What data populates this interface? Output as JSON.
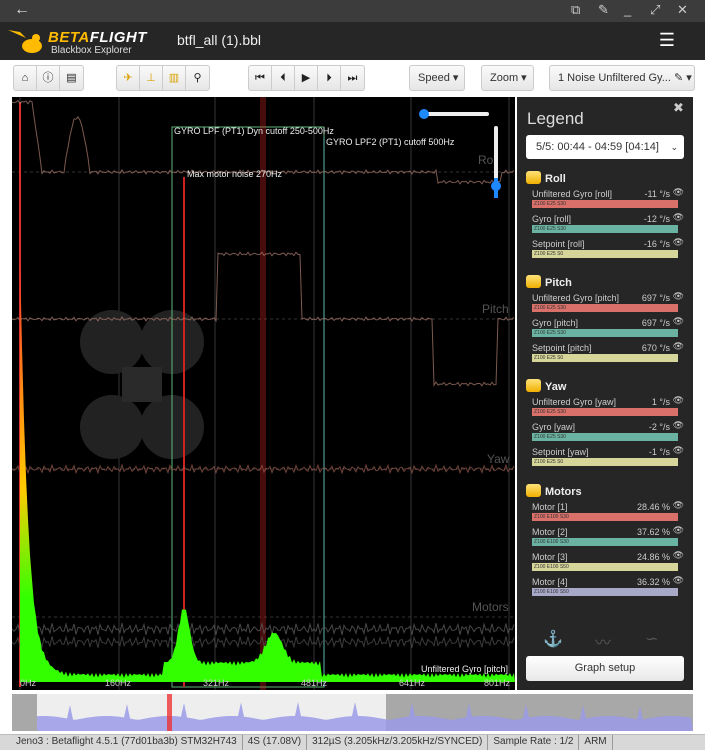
{
  "window": {
    "back_icon": "arrow-left-icon",
    "controls": [
      "screenshot-icon",
      "pin-icon",
      "minimize-icon",
      "maximize-icon",
      "close-icon"
    ]
  },
  "header": {
    "brand_a": "BETA",
    "brand_b": "FLIGHT",
    "subtitle": "Blackbox Explorer",
    "filename": "btfl_all (1).bbl",
    "menu_icon": "hamburger-icon"
  },
  "toolbar": {
    "group1": [
      "home-icon",
      "info-icon",
      "table-icon"
    ],
    "group2": [
      "craft-icon",
      "sticks-icon",
      "spectrum-icon",
      "map-pin-icon"
    ],
    "group3": [
      "jump-start-icon",
      "step-back-icon",
      "play-icon",
      "step-forward-icon",
      "jump-end-icon"
    ],
    "speed": "Speed ▾",
    "zoom": "Zoom ▾",
    "graph_select": "1 Noise Unfiltered Gy... ✎ ▾"
  },
  "chart": {
    "annotations": {
      "lpf1": "GYRO LPF (PT1) Dyn cutoff 250-500Hz",
      "lpf2": "GYRO LPF2 (PT1) cutoff 500Hz",
      "motor_noise": "Max motor noise 270Hz"
    },
    "graph_labels": {
      "roll": "Roll",
      "pitch": "Pitch",
      "yaw": "Yaw",
      "motors": "Motors"
    },
    "spectrum_label": "Unfiltered Gyro [pitch]",
    "x_ticks": [
      "0Hz",
      "160Hz",
      "321Hz",
      "481Hz",
      "641Hz",
      "801Hz"
    ],
    "colors": {
      "spectrum": "#33ff00",
      "filter_line": "#5fb87a",
      "motor_noise_line": "#cc2222",
      "cursor": "#cc2222"
    }
  },
  "legend": {
    "title": "Legend",
    "close_icon": "close-icon",
    "range": "5/5: 00:44 - 04:59 [04:14]",
    "sections": [
      {
        "name": "Roll",
        "items": [
          {
            "label": "Unfiltered Gyro [roll]",
            "value": "-11 °/s",
            "tag": "Z100 E25 S30",
            "color": "#d9706a"
          },
          {
            "label": "Gyro [roll]",
            "value": "-12 °/s",
            "tag": "Z100 E25 S30",
            "color": "#6ab3a2"
          },
          {
            "label": "Setpoint [roll]",
            "value": "-16 °/s",
            "tag": "Z100 E25 S0",
            "color": "#d6d69a"
          }
        ]
      },
      {
        "name": "Pitch",
        "items": [
          {
            "label": "Unfiltered Gyro [pitch]",
            "value": "697 °/s",
            "tag": "Z100 E25 S30",
            "color": "#d9706a"
          },
          {
            "label": "Gyro [pitch]",
            "value": "697 °/s",
            "tag": "Z100 E25 S30",
            "color": "#6ab3a2"
          },
          {
            "label": "Setpoint [pitch]",
            "value": "670 °/s",
            "tag": "Z100 E25 S0",
            "color": "#d6d69a"
          }
        ]
      },
      {
        "name": "Yaw",
        "items": [
          {
            "label": "Unfiltered Gyro [yaw]",
            "value": "1 °/s",
            "tag": "Z100 E25 S30",
            "color": "#d9706a"
          },
          {
            "label": "Gyro [yaw]",
            "value": "-2 °/s",
            "tag": "Z100 E25 S30",
            "color": "#6ab3a2"
          },
          {
            "label": "Setpoint [yaw]",
            "value": "-1 °/s",
            "tag": "Z100 E25 S0",
            "color": "#d6d69a"
          }
        ]
      },
      {
        "name": "Motors",
        "items": [
          {
            "label": "Motor [1]",
            "value": "28.46 %",
            "tag": "Z100 E100 S30",
            "color": "#d9706a"
          },
          {
            "label": "Motor [2]",
            "value": "37.62 %",
            "tag": "Z100 E100 S30",
            "color": "#6ab3a2"
          },
          {
            "label": "Motor [3]",
            "value": "24.86 %",
            "tag": "Z100 E100 S50",
            "color": "#d6d69a"
          },
          {
            "label": "Motor [4]",
            "value": "36.32 %",
            "tag": "Z100 E100 S50",
            "color": "#a8a8c8"
          }
        ]
      }
    ],
    "view_icons": [
      "sticks-view-icon",
      "graph-view-icon",
      "curve-view-icon"
    ],
    "graph_setup": "Graph setup"
  },
  "status": [
    "Jeno3 : Betaflight 4.5.1 (77d01ba3b) STM32H743",
    "4S (17.08V)",
    "312µS (3.205kHz/3.205kHz/SYNCED)",
    "Sample Rate : 1/2",
    "ARM"
  ]
}
